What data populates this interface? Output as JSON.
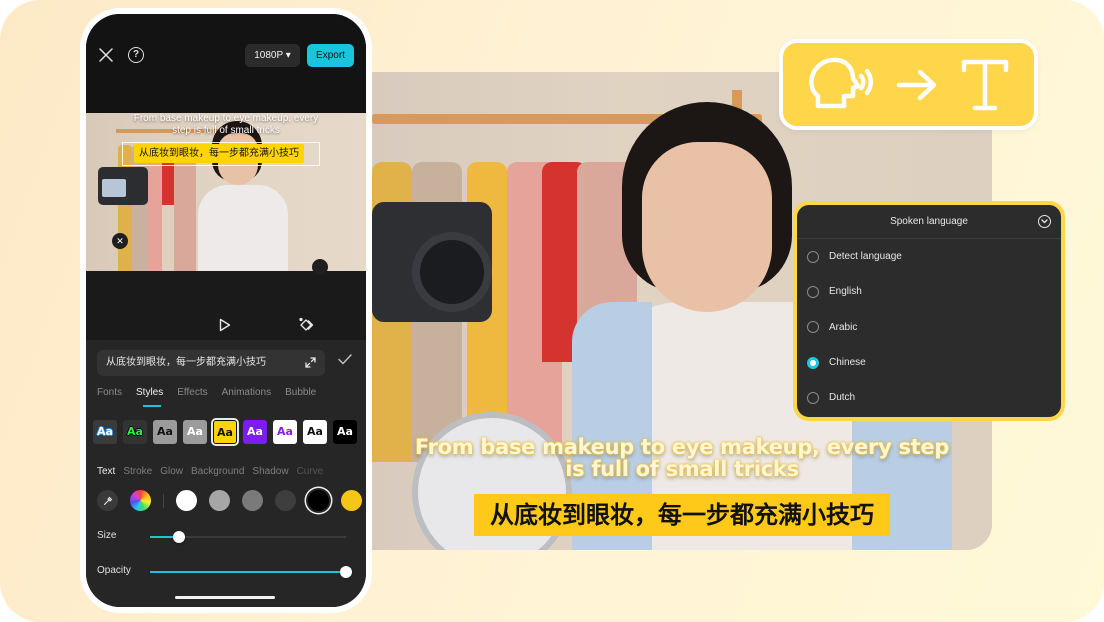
{
  "colors": {
    "accent": "#19c5dc",
    "highlight_yellow": "#ffd54a",
    "subtitle_yellow": "#ffc91a",
    "panel_dark": "#2c2c2c"
  },
  "phone": {
    "topbar": {
      "close_icon": "close-icon",
      "help_icon": "help-icon",
      "help_glyph": "?",
      "resolution_label": "1080P ▾",
      "export_label": "Export"
    },
    "preview": {
      "subtitle_en": "From base makeup to eye makeup, every step is full of small tricks",
      "subtitle_zh": "从底妆到眼妆，每一步都充满小技巧",
      "delete_glyph": "✕"
    },
    "controls": {
      "play_icon": "play-icon",
      "keyframe_icon": "keyframe-icon"
    },
    "editor": {
      "text_value": "从底妆到眼妆，每一步都充满小技巧",
      "tabs": [
        {
          "label": "Fonts",
          "active": false
        },
        {
          "label": "Styles",
          "active": true
        },
        {
          "label": "Effects",
          "active": false
        },
        {
          "label": "Animations",
          "active": false
        },
        {
          "label": "Bubble",
          "active": false
        }
      ],
      "style_presets": [
        {
          "label": "Aa",
          "name": "blue-outline"
        },
        {
          "label": "Aa",
          "name": "green-outline"
        },
        {
          "label": "Aa",
          "name": "black-on-gray"
        },
        {
          "label": "Aa",
          "name": "white-on-gray"
        },
        {
          "label": "Aa",
          "name": "black-on-yellow",
          "selected": true
        },
        {
          "label": "Aa",
          "name": "white-on-purple"
        },
        {
          "label": "Aa",
          "name": "purple-on-white"
        },
        {
          "label": "Aa",
          "name": "black-on-white"
        },
        {
          "label": "Aa",
          "name": "white-on-black"
        }
      ],
      "subtabs": [
        {
          "label": "Text",
          "active": true
        },
        {
          "label": "Stroke",
          "active": false
        },
        {
          "label": "Glow",
          "active": false
        },
        {
          "label": "Background",
          "active": false
        },
        {
          "label": "Shadow",
          "active": false
        },
        {
          "label": "Curve",
          "active": false
        }
      ],
      "swatch_colors": [
        "#ffffff",
        "#a6a6a6",
        "#7a7a7a",
        "#3e3e3e",
        "#000000",
        "#f5c518"
      ],
      "selected_swatch": "#000000",
      "size": {
        "label": "Size",
        "value_fraction": 0.15
      },
      "opacity": {
        "label": "Opacity",
        "value_fraction": 1.0
      }
    }
  },
  "hero": {
    "subtitle_en": "From base makeup to eye makeup, every step is full of small tricks",
    "subtitle_zh": "从底妆到眼妆，每一步都充满小技巧"
  },
  "speech_to_text_badge": {
    "icons": [
      "speaking-head-icon",
      "arrow-right-icon",
      "text-icon"
    ]
  },
  "language_panel": {
    "title": "Spoken language",
    "options": [
      {
        "label": "Detect language",
        "selected": false
      },
      {
        "label": "English",
        "selected": false
      },
      {
        "label": "Arabic",
        "selected": false
      },
      {
        "label": "Chinese",
        "selected": true
      },
      {
        "label": "Dutch",
        "selected": false
      }
    ]
  }
}
